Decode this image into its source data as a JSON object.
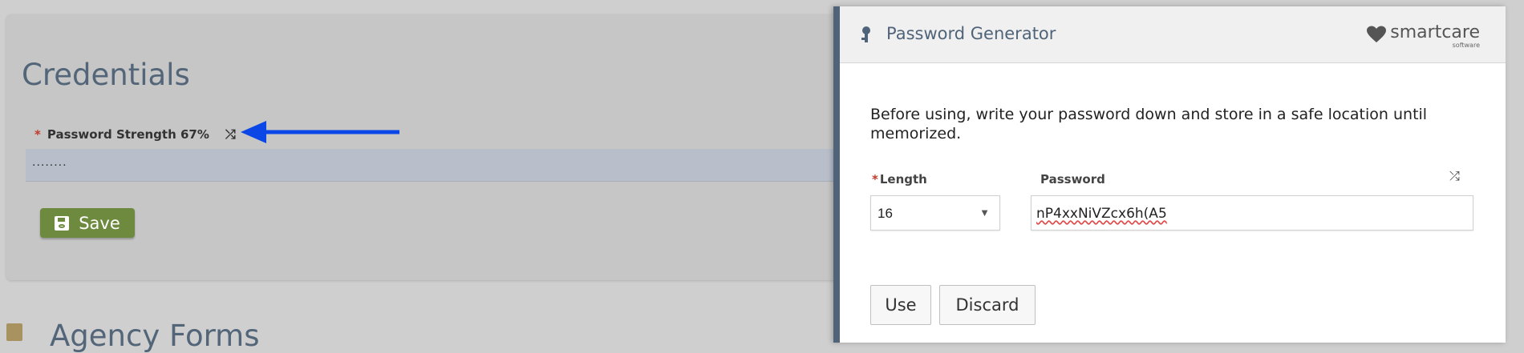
{
  "page": {
    "card_title": "Credentials",
    "password_field": {
      "required_mark": "*",
      "label": "Password Strength 67%",
      "shuffle_icon": "shuffle-icon",
      "masked_value": "........"
    },
    "save_button": {
      "icon": "floppy-disk-icon",
      "label": "Save"
    },
    "annotation_arrow": {
      "color": "#0b47e6",
      "direction": "left"
    },
    "next_section": {
      "icon": "clipboard-icon",
      "heading": "Agency Forms"
    }
  },
  "modal": {
    "title_icon": "key-icon",
    "title": "Password Generator",
    "logo": {
      "main": "smartcare",
      "sub": "software",
      "icon": "heart-icon"
    },
    "note": "Before using, write your password down and store in a safe location until memorized.",
    "length": {
      "required_mark": "*",
      "label": "Length",
      "value": "16",
      "caret_icon": "caret-down-icon"
    },
    "password": {
      "label": "Password",
      "value": "nP4xxNiVZcx6h(A5",
      "shuffle_icon": "shuffle-icon"
    },
    "buttons": {
      "use": "Use",
      "discard": "Discard"
    }
  },
  "colors": {
    "accent_blue": "#4f6379",
    "save_green": "#6e8a3f",
    "arrow_blue": "#0b47e6",
    "required_red": "#c0392b"
  }
}
